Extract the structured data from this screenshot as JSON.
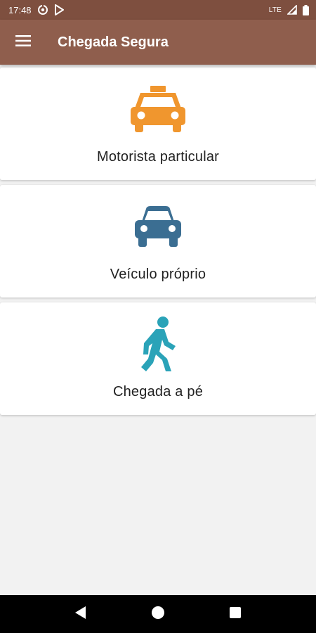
{
  "status_bar": {
    "time": "17:48",
    "network": "LTE",
    "icons": [
      "data-saver-icon",
      "play-store-icon",
      "signal-icon",
      "battery-icon"
    ]
  },
  "app_bar": {
    "title": "Chegada Segura",
    "menu_icon": "hamburger-menu-icon"
  },
  "options": [
    {
      "label": "Motorista particular",
      "icon": "taxi-icon",
      "color": "#f0962e"
    },
    {
      "label": "Veículo próprio",
      "icon": "car-icon",
      "color": "#3b6e92"
    },
    {
      "label": "Chegada a pé",
      "icon": "walking-person-icon",
      "color": "#2aa3b8"
    }
  ],
  "colors": {
    "status_bar": "#7e4f3f",
    "app_bar": "#8f5e4d",
    "background": "#f2f2f2"
  },
  "navigation": {
    "buttons": [
      "back-icon",
      "home-icon",
      "recents-icon"
    ]
  }
}
